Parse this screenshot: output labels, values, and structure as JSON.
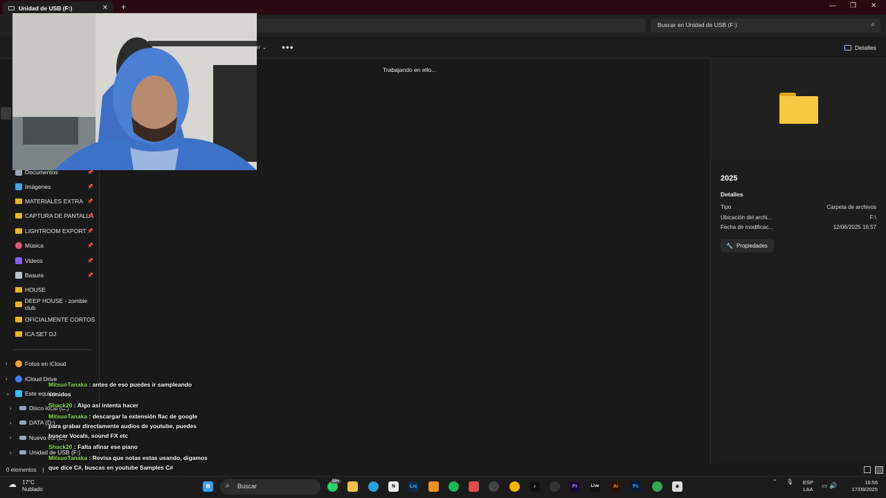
{
  "window": {
    "tab_title": "Unidad de USB (F:)",
    "search_placeholder": "Buscar en Unidad de USB (F:)",
    "command_partial": "er",
    "details_button": "Detalles",
    "loading_text": "Trabajando en ello..."
  },
  "sidebar": {
    "items": [
      {
        "label": "Documentos",
        "icon": "document-icon",
        "pinned": true
      },
      {
        "label": "Imágenes",
        "icon": "images-icon",
        "pinned": true
      },
      {
        "label": "MATERIALES EXTRA",
        "icon": "folder-icon",
        "pinned": true
      },
      {
        "label": "CAPTURA DE PANTALLA",
        "icon": "folder-icon",
        "pinned": true
      },
      {
        "label": "LIGHTROOM EXPORT",
        "icon": "folder-icon",
        "pinned": true
      },
      {
        "label": "Música",
        "icon": "music-icon",
        "pinned": true
      },
      {
        "label": "Videos",
        "icon": "videos-icon",
        "pinned": true
      },
      {
        "label": "Basura",
        "icon": "trash-icon",
        "pinned": true
      },
      {
        "label": "HOUSE",
        "icon": "folder-icon",
        "pinned": false
      },
      {
        "label": "DEEP HOUSE - zombie club",
        "icon": "folder-icon",
        "pinned": false
      },
      {
        "label": "OFICIALMENTE CORTOS",
        "icon": "folder-icon",
        "pinned": false
      },
      {
        "label": "ICA SET DJ",
        "icon": "folder-icon",
        "pinned": false
      }
    ],
    "tree": [
      {
        "label": "Fotos en iCloud"
      },
      {
        "label": "iCloud Drive"
      },
      {
        "label": "Este equipo"
      },
      {
        "label": "Disco local (C:)"
      },
      {
        "label": "DATA (D:)"
      },
      {
        "label": "Nuevo vol (E:)"
      },
      {
        "label": "Unidad de USB (F:)"
      }
    ]
  },
  "details": {
    "name": "2025",
    "section": "Detalles",
    "rows": [
      {
        "key": "Tipo",
        "value": "Carpeta de archivos"
      },
      {
        "key": "Ubicación del archi...",
        "value": "F:\\"
      },
      {
        "key": "Fecha de modificac...",
        "value": "12/06/2025 16:57"
      }
    ],
    "properties_button": "Propiedades"
  },
  "status": {
    "items_count": "0 elementos",
    "separator": "|"
  },
  "chat": [
    {
      "user": "MitsuoTanaka",
      "text": ": antes de eso puedes ir sampleando sonidos"
    },
    {
      "user": "Shack20",
      "text": ": Algo así intenta hacer"
    },
    {
      "user": "MitsuoTanaka",
      "text": ": descargar la extensión flac de google para grabar directamente audios de youtube, puedes buscar Vocals, sound FX etc"
    },
    {
      "user": "Shack20",
      "text": ": Falta afinar ese piano"
    },
    {
      "user": "MitsuoTanaka",
      "text": ": Revisa que notas estas usando, digamos que dice C#, buscas en youtube Samples C#"
    }
  ],
  "taskbar": {
    "weather_temp": "17°C",
    "weather_desc": "Nublado",
    "search_label": "Buscar",
    "badge": "99+",
    "lang_1": "ESP",
    "lang_2": "LAA",
    "time": "16:56",
    "date": "17/09/2025",
    "icons": [
      "windows-icon",
      "whatsapp-icon",
      "file-explorer-icon",
      "telegram-icon",
      "notion-icon",
      "lightroom-icon",
      "fl-studio-icon",
      "spotify-icon",
      "snipping-icon",
      "capcut-icon",
      "chrome-icon",
      "tiktok-icon",
      "chatgpt-icon",
      "premiere-icon",
      "ableton-live-icon",
      "illustrator-icon",
      "photoshop-icon",
      "chrome-profile-icon",
      "unity-icon"
    ],
    "icon_labels": {
      "lightroom": "Lrc",
      "premiere": "Pr",
      "live": "Live",
      "illustrator": "Ai",
      "photoshop": "Ps"
    }
  }
}
